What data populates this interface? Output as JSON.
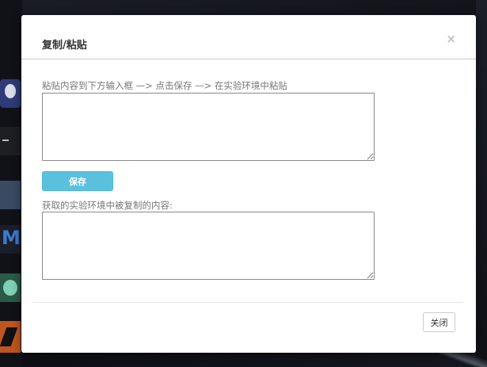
{
  "dialog": {
    "title": "复制/粘贴",
    "close_symbol": "×",
    "paste_instruction": "粘贴内容到下方输入框 —> 点击保存 —> 在实验环境中粘贴",
    "paste_input_value": "",
    "save_label": "保存",
    "copied_label": "获取的实验环境中被复制的内容:",
    "copied_output_value": "",
    "close_label": "关闭"
  },
  "colors": {
    "save_button": "#5bc0de",
    "overlay": "#0f1116"
  },
  "desktop": {
    "dock_icons": [
      "avatar-app-icon",
      "terminal-icon",
      "folder-icon",
      "metasploit-icon",
      "character-app-icon",
      "burp-suite-icon"
    ]
  }
}
